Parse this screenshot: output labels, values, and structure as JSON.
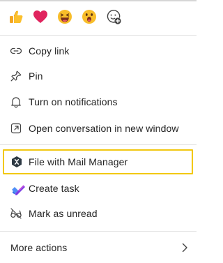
{
  "reactions": [
    {
      "name": "thumbs-up-emoji"
    },
    {
      "name": "heart-emoji"
    },
    {
      "name": "laughing-emoji"
    },
    {
      "name": "surprised-emoji"
    },
    {
      "name": "add-reaction-icon"
    }
  ],
  "menu": {
    "copy_link": "Copy link",
    "pin": "Pin",
    "notifications": "Turn on notifications",
    "open_window": "Open conversation in new window",
    "mail_manager": "File with Mail Manager",
    "create_task": "Create task",
    "mark_unread": "Mark as unread",
    "more_actions": "More actions"
  },
  "colors": {
    "highlight_border": "#f2c811",
    "text": "#242424",
    "icon": "#424242"
  }
}
